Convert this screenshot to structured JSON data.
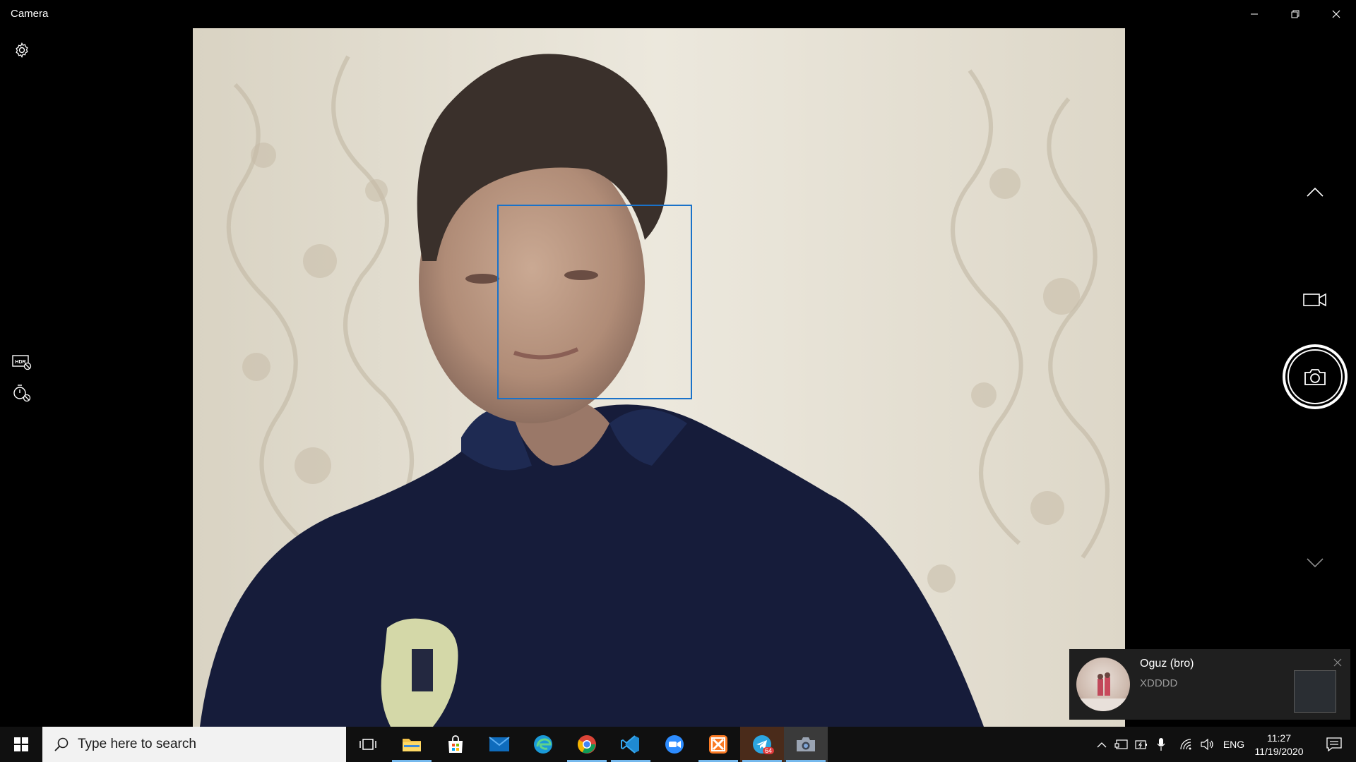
{
  "window": {
    "title": "Camera",
    "controls": {
      "minimize": "minimize-icon",
      "restore": "restore-icon",
      "close": "close-icon"
    }
  },
  "left_rail": {
    "settings": "gear-icon",
    "hdr": "hdr-off-icon",
    "timer": "timer-off-icon"
  },
  "right_rail": {
    "up": "chevron-up-icon",
    "video_mode": "video-camera-icon",
    "take_photo": "camera-shutter-icon",
    "down": "chevron-down-icon"
  },
  "colors": {
    "face_box": "#1a72c9",
    "taskbar": "#101010",
    "accent_running": "#76b9ed",
    "toast_bg": "#1f1f1f"
  },
  "notification": {
    "sender": "Oguz (bro)",
    "message": "XDDDD"
  },
  "taskbar": {
    "search_placeholder": "Type here to search",
    "pinned": [
      {
        "name": "task-view-icon",
        "running": false
      },
      {
        "name": "file-explorer-icon",
        "running": true
      },
      {
        "name": "microsoft-store-icon",
        "running": false
      },
      {
        "name": "mail-icon",
        "running": false
      },
      {
        "name": "edge-icon",
        "running": false
      },
      {
        "name": "chrome-icon",
        "running": true
      },
      {
        "name": "vscode-icon",
        "running": true
      },
      {
        "name": "zoom-icon",
        "running": false
      },
      {
        "name": "xampp-icon",
        "running": true
      },
      {
        "name": "telegram-icon",
        "running": true,
        "badge": "64"
      },
      {
        "name": "camera-app-icon",
        "running": true,
        "active": true
      }
    ],
    "tray": {
      "language": "ENG",
      "time": "11:27",
      "date": "11/19/2020"
    }
  }
}
